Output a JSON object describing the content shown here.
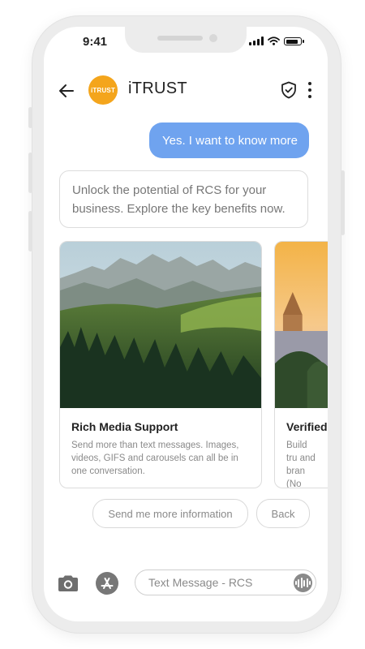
{
  "status_bar": {
    "time": "9:41"
  },
  "header": {
    "logo_text": "iTRUST",
    "brand_name": "iTRUST"
  },
  "messages": {
    "outgoing": "Yes. I want to know more",
    "incoming": "Unlock the potential of RCS for your business. Explore the key benefits now."
  },
  "carousel": {
    "cards": [
      {
        "title": "Rich Media Support",
        "description": "Send more than text messages. Images, videos, GIFS and carousels can all be in one conversation."
      },
      {
        "title": "Verified",
        "description": "Build tru and bran (No shor"
      }
    ]
  },
  "suggestions": {
    "more_info": "Send me more information",
    "back": "Back"
  },
  "composer": {
    "placeholder": "Text Message - RCS"
  },
  "colors": {
    "accent": "#6fa3ef",
    "brand": "#f4a51c"
  }
}
